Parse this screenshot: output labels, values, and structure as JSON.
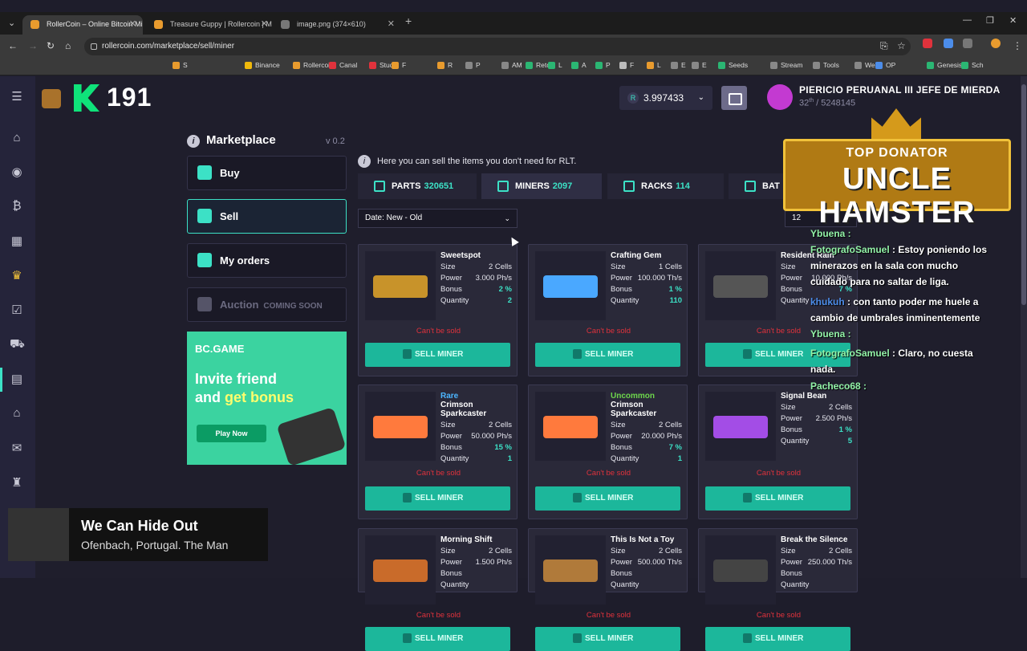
{
  "browser": {
    "tabs": [
      {
        "title": "RollerCoin – Online Bitcoin Min",
        "active": true
      },
      {
        "title": "Treasure Guppy | Rollercoin | M",
        "active": false
      },
      {
        "title": "image.png (374×610)",
        "active": false
      }
    ],
    "url": "rollercoin.com/marketplace/sell/miner",
    "bookmarks": [
      {
        "label": "S",
        "color": "#e89b2e"
      },
      {
        "label": "Binance",
        "color": "#f0b90b"
      },
      {
        "label": "Rollercoin",
        "color": "#e89b2e"
      },
      {
        "label": "Canal",
        "color": "#e0323c"
      },
      {
        "label": "Studio",
        "color": "#e0323c"
      },
      {
        "label": "F",
        "color": "#e89b2e"
      },
      {
        "label": "R",
        "color": "#e89b2e"
      },
      {
        "label": "P",
        "color": "#888888"
      },
      {
        "label": "AM",
        "color": "#888888"
      },
      {
        "label": "Reto",
        "color": "#2bb673"
      },
      {
        "label": "L",
        "color": "#2bb673"
      },
      {
        "label": "A",
        "color": "#2bb673"
      },
      {
        "label": "P",
        "color": "#2bb673"
      },
      {
        "label": "F",
        "color": "#bbbbbb"
      },
      {
        "label": "L",
        "color": "#e89b2e"
      },
      {
        "label": "E",
        "color": "#888888"
      },
      {
        "label": "E",
        "color": "#888888"
      },
      {
        "label": "Seeds",
        "color": "#2bb673"
      },
      {
        "label": "Stream",
        "color": "#888888"
      },
      {
        "label": "Tools",
        "color": "#888888"
      },
      {
        "label": "Web",
        "color": "#888888"
      },
      {
        "label": "OP",
        "color": "#4c8dea"
      },
      {
        "label": "Genesis",
        "color": "#2bb673"
      },
      {
        "label": "Sch",
        "color": "#2bb673"
      },
      {
        "label": "Vistas",
        "color": "#2bb673"
      }
    ]
  },
  "header": {
    "level": "191",
    "balance": "3.997433",
    "balance_symbol": "R",
    "username": "PIERICIO PERUANAL III JEFE DE MIERDA",
    "rank_num": "32",
    "rank_sup": "th",
    "rank_total": "/ 5248145"
  },
  "sidebar": {
    "marketplace": "Marketplace",
    "version": "v 0.2",
    "buy": "Buy",
    "sell": "Sell",
    "orders": "My orders",
    "auction": "Auction",
    "auction_soon": "COMING SOON"
  },
  "ad": {
    "brand": "BC.GAME",
    "line1": "Invite friend",
    "line2a": "and ",
    "line2b": "get bonus",
    "play": "Play Now"
  },
  "main": {
    "info": "Here you can sell the items you don't need for RLT.",
    "categories": [
      {
        "label": "PARTS",
        "count": "320651"
      },
      {
        "label": "MINERS",
        "count": "2097"
      },
      {
        "label": "RACKS",
        "count": "114"
      },
      {
        "label": "BAT",
        "count": ""
      }
    ],
    "sort": "Date: New - Old",
    "per_page": "12",
    "labels": {
      "size": "Size",
      "power": "Power",
      "bonus": "Bonus",
      "quantity": "Quantity",
      "cant": "Can't be sold",
      "sell": "SELL MINER"
    },
    "cards": [
      {
        "name": "Sweetspot",
        "rarity": "",
        "size": "2 Cells",
        "power": "3.000 Ph/s",
        "bonus": "2 %",
        "qty": "2"
      },
      {
        "name": "Crafting Gem",
        "rarity": "",
        "size": "1 Cells",
        "power": "100.000 Th/s",
        "bonus": "1 %",
        "qty": "110"
      },
      {
        "name": "Resident Rain",
        "rarity": "",
        "size": "",
        "power": "10.000 Ph/s",
        "bonus": "7 %",
        "qty": ""
      },
      {
        "name": "Crimson Sparkcaster",
        "rarity": "Rare",
        "size": "2 Cells",
        "power": "50.000 Ph/s",
        "bonus": "15 %",
        "qty": "1"
      },
      {
        "name": "Crimson Sparkcaster",
        "rarity": "Uncommon",
        "size": "2 Cells",
        "power": "20.000 Ph/s",
        "bonus": "7 %",
        "qty": "1"
      },
      {
        "name": "Signal Bean",
        "rarity": "",
        "size": "2 Cells",
        "power": "2.500 Ph/s",
        "bonus": "1 %",
        "qty": "5"
      },
      {
        "name": "Morning Shift",
        "rarity": "",
        "size": "2 Cells",
        "power": "1.500 Ph/s",
        "bonus": "",
        "qty": ""
      },
      {
        "name": "This Is Not a Toy",
        "rarity": "",
        "size": "2 Cells",
        "power": "500.000 Th/s",
        "bonus": "",
        "qty": ""
      },
      {
        "name": "Break the Silence",
        "rarity": "",
        "size": "2 Cells",
        "power": "250.000 Th/s",
        "bonus": "",
        "qty": ""
      }
    ]
  },
  "overlay": {
    "don_top": "TOP DONATOR",
    "don_name": "UNCLE HAMSTER",
    "chat": [
      {
        "user": "Ybuena :",
        "msg": ""
      },
      {
        "user": "FotografoSamuel",
        "msg": ": Estoy poniendo los minerazos en la sala con mucho cuidado para no saltar de liga."
      },
      {
        "user": "khukuh",
        "msg": ": con tanto poder me huele a cambio de umbrales inminentemente"
      },
      {
        "user": "Ybuena :",
        "msg": ""
      },
      {
        "user": "FotografoSamuel",
        "msg": ": Claro, no cuesta nada."
      },
      {
        "user": "Pacheco68 :",
        "msg": ""
      }
    ],
    "song": "We Can Hide Out",
    "artist": "Ofenbach, Portugal. The Man"
  }
}
